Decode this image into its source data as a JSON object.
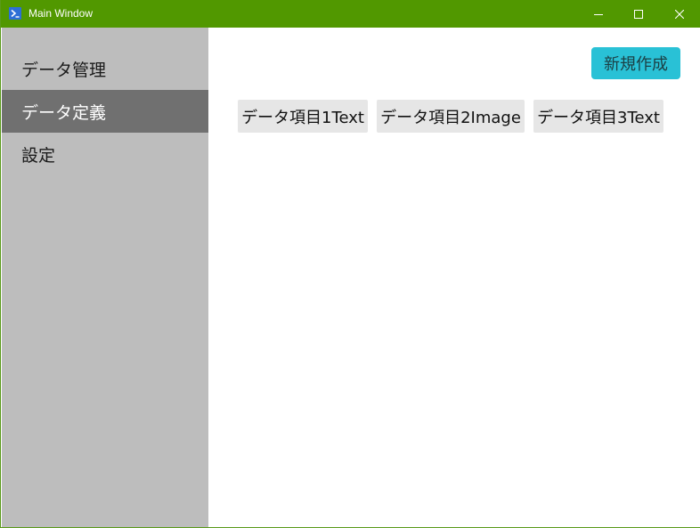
{
  "window": {
    "title": "Main Window",
    "app_icon": "powershell-icon",
    "titlebar_color": "#519800",
    "controls": {
      "minimize_icon": "minimize-icon",
      "maximize_icon": "maximize-icon",
      "close_icon": "close-icon"
    }
  },
  "sidebar": {
    "background": "#bdbdbd",
    "active_color": "#707070",
    "items": [
      {
        "label": "データ管理",
        "active": false
      },
      {
        "label": "データ定義",
        "active": true
      },
      {
        "label": "設定",
        "active": false
      }
    ]
  },
  "main": {
    "new_button": {
      "label": "新規作成",
      "color": "#29c1d6"
    },
    "data_items": [
      {
        "label": "データ項目1Text"
      },
      {
        "label": "データ項目2Image"
      },
      {
        "label": "データ項目3Text"
      }
    ]
  }
}
